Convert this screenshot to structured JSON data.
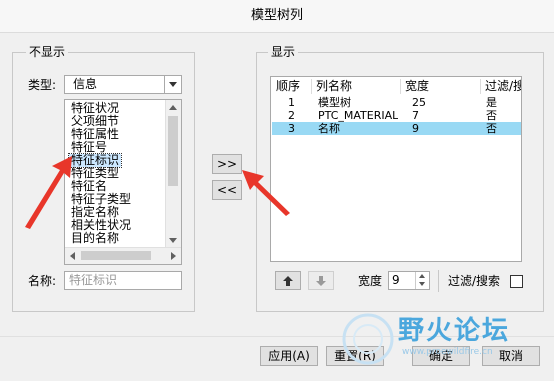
{
  "window": {
    "title": "模型树列"
  },
  "left_group": {
    "legend": "不显示",
    "type_label": "类型:",
    "type_value": "信息",
    "items": [
      "特征状况",
      "父项细节",
      "特征属性",
      "特征号",
      "特征标识",
      "特征类型",
      "特征名",
      "特征子类型",
      "指定名称",
      "相关性状况",
      "目的名称"
    ],
    "selected_index": 4,
    "name_label": "名称:",
    "name_placeholder": "特征标识"
  },
  "transfer": {
    "add_label": ">>",
    "remove_label": "<<"
  },
  "right_group": {
    "legend": "显示",
    "columns": [
      "顺序",
      "列名称",
      "宽度",
      "过滤/搜"
    ],
    "rows": [
      {
        "order": "1",
        "name": "模型树",
        "width": "25",
        "filter": "是"
      },
      {
        "order": "2",
        "name": "PTC_MATERIAL_NAME",
        "width": "7",
        "filter": "否"
      },
      {
        "order": "3",
        "name": "名称",
        "width": "9",
        "filter": "否"
      }
    ],
    "selected_row": 2,
    "width_label": "宽度",
    "width_value": "9",
    "filter_label": "过滤/搜索"
  },
  "footer": {
    "apply": "应用(A)",
    "reset": "重置(R)",
    "ok": "确定",
    "cancel": "取消"
  },
  "watermark": {
    "text": "野火论坛",
    "url": "www.proewildfire.cn"
  },
  "colors": {
    "selection": "#cce8ff",
    "row_selection": "#99d9f4",
    "arrow": "#e8362a",
    "watermark": "#3aa0dc"
  }
}
